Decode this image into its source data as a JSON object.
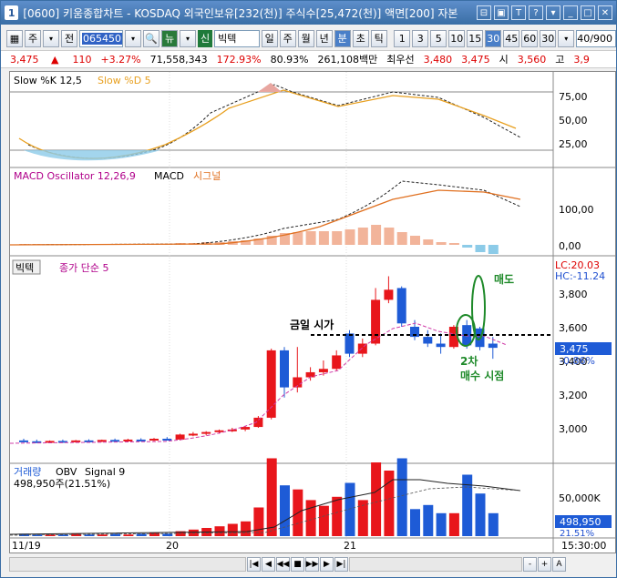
{
  "window": {
    "number": "1",
    "title": "[0600] 키움종합차트 - KOSDAQ 외국인보유[232(천)] 주식수[25,472(천)] 액면[200] 자본",
    "controls": [
      "⊟",
      "▣",
      "T",
      "?",
      "▾",
      "_",
      "□",
      "✕"
    ]
  },
  "toolbar": {
    "period_unit": "주",
    "all_label": "전",
    "stock_code": "065450",
    "stock_name": "빅텍",
    "new_badge": "신",
    "group_icon": "뉴",
    "periods": [
      "일",
      "주",
      "월",
      "년",
      "분",
      "초",
      "틱"
    ],
    "active_period": "분",
    "minutes": [
      "1",
      "3",
      "5",
      "10",
      "15",
      "30",
      "45",
      "60"
    ],
    "active_minute": "30",
    "interval_value": "30",
    "page": "40/900"
  },
  "quote": {
    "price": "3,475",
    "arrow": "▲",
    "change": "110",
    "change_pct": "+3.27%",
    "volume": "71,558,343",
    "vol_ratio": "172.93%",
    "strength": "80.93%",
    "amount": "261,108백만",
    "priority_label": "최우선",
    "bid1": "3,480",
    "bid2": "3,475",
    "open_label": "시",
    "open": "3,560",
    "high_label": "고",
    "high": "3,9"
  },
  "panels": {
    "stochastic": {
      "title_k": "Slow %K 12,5",
      "title_d": "Slow %D 5",
      "axis": [
        "75,00",
        "50,00",
        "25,00"
      ]
    },
    "macd": {
      "title_osc": "MACD Oscillator 12,26,9",
      "title_macd": "MACD",
      "title_signal": "시그널",
      "axis": [
        "100,00",
        "0,00"
      ]
    },
    "price": {
      "name_tag": "빅텍",
      "ma_label": "종가 단순 5",
      "lc": "LC:20.03",
      "hc": "HC:-11.24",
      "axis": [
        "3,800",
        "3,600",
        "3,400",
        "3,200",
        "3,000"
      ],
      "current": "3,475",
      "current_pct": "-0.86%",
      "annotation_open": "금일 시가",
      "annotation_sell": "매도",
      "annotation_buy_1": "2차",
      "annotation_buy_2": "매수 시점"
    },
    "volume": {
      "title_vol": "거래량",
      "title_obv": "OBV",
      "title_signal": "Signal 9",
      "value": "498,950주(21.51%)",
      "axis": [
        "50,000K"
      ],
      "current": "498,950",
      "current_pct": "21.51%"
    },
    "xaxis": {
      "labels": [
        "11/19",
        "20",
        "21"
      ],
      "time": "15:30:00"
    }
  },
  "scroll": {
    "buttons": [
      "|◀",
      "◀",
      "◀◀",
      "■",
      "▶▶",
      "▶",
      "▶|",
      "-",
      "+",
      "A"
    ]
  },
  "colors": {
    "up": "#e8161b",
    "down": "#1e5bd6",
    "accent": "#3a6ea5",
    "annotation": "#1f8a2a",
    "ma": "#d03ca8"
  },
  "chart_data": {
    "type": "candlestick",
    "unit": "30 min",
    "ylim": [
      2900,
      3950
    ],
    "candles": [
      {
        "o": 2925,
        "h": 2935,
        "l": 2915,
        "c": 2920
      },
      {
        "o": 2920,
        "h": 2930,
        "l": 2912,
        "c": 2915
      },
      {
        "o": 2915,
        "h": 2925,
        "l": 2910,
        "c": 2922
      },
      {
        "o": 2922,
        "h": 2930,
        "l": 2915,
        "c": 2918
      },
      {
        "o": 2918,
        "h": 2928,
        "l": 2912,
        "c": 2925
      },
      {
        "o": 2925,
        "h": 2932,
        "l": 2918,
        "c": 2920
      },
      {
        "o": 2920,
        "h": 2930,
        "l": 2915,
        "c": 2928
      },
      {
        "o": 2928,
        "h": 2936,
        "l": 2920,
        "c": 2925
      },
      {
        "o": 2925,
        "h": 2935,
        "l": 2918,
        "c": 2930
      },
      {
        "o": 2930,
        "h": 2938,
        "l": 2922,
        "c": 2926
      },
      {
        "o": 2926,
        "h": 2940,
        "l": 2920,
        "c": 2935
      },
      {
        "o": 2935,
        "h": 2945,
        "l": 2928,
        "c": 2930
      },
      {
        "o": 2930,
        "h": 2965,
        "l": 2925,
        "c": 2960
      },
      {
        "o": 2960,
        "h": 2975,
        "l": 2950,
        "c": 2965
      },
      {
        "o": 2965,
        "h": 2980,
        "l": 2955,
        "c": 2975
      },
      {
        "o": 2975,
        "h": 2990,
        "l": 2965,
        "c": 2985
      },
      {
        "o": 2985,
        "h": 3000,
        "l": 2975,
        "c": 2990
      },
      {
        "o": 2990,
        "h": 3010,
        "l": 2980,
        "c": 3005
      },
      {
        "o": 3005,
        "h": 3070,
        "l": 3000,
        "c": 3060
      },
      {
        "o": 3060,
        "h": 3470,
        "l": 3050,
        "c": 3460
      },
      {
        "o": 3460,
        "h": 3480,
        "l": 3180,
        "c": 3240
      },
      {
        "o": 3240,
        "h": 3480,
        "l": 3210,
        "c": 3300
      },
      {
        "o": 3300,
        "h": 3360,
        "l": 3280,
        "c": 3330
      },
      {
        "o": 3330,
        "h": 3400,
        "l": 3310,
        "c": 3350
      },
      {
        "o": 3350,
        "h": 3460,
        "l": 3340,
        "c": 3430
      },
      {
        "o": 3560,
        "h": 3580,
        "l": 3420,
        "c": 3440
      },
      {
        "o": 3440,
        "h": 3530,
        "l": 3420,
        "c": 3500
      },
      {
        "o": 3500,
        "h": 3830,
        "l": 3490,
        "c": 3760
      },
      {
        "o": 3760,
        "h": 3900,
        "l": 3740,
        "c": 3820
      },
      {
        "o": 3830,
        "h": 3840,
        "l": 3600,
        "c": 3620
      },
      {
        "o": 3600,
        "h": 3640,
        "l": 3520,
        "c": 3540
      },
      {
        "o": 3540,
        "h": 3580,
        "l": 3480,
        "c": 3500
      },
      {
        "o": 3500,
        "h": 3560,
        "l": 3440,
        "c": 3480
      },
      {
        "o": 3480,
        "h": 3610,
        "l": 3470,
        "c": 3600
      },
      {
        "o": 3610,
        "h": 3640,
        "l": 3470,
        "c": 3490
      },
      {
        "o": 3590,
        "h": 3600,
        "l": 3460,
        "c": 3480
      },
      {
        "o": 3500,
        "h": 3540,
        "l": 3410,
        "c": 3475
      }
    ],
    "volume": [
      3,
      2,
      2,
      2,
      3,
      2,
      2,
      3,
      2,
      3,
      4,
      3,
      6,
      8,
      10,
      12,
      15,
      18,
      35,
      95,
      62,
      57,
      44,
      37,
      48,
      65,
      44,
      90,
      80,
      95,
      33,
      38,
      28,
      28,
      75,
      52,
      28
    ]
  }
}
